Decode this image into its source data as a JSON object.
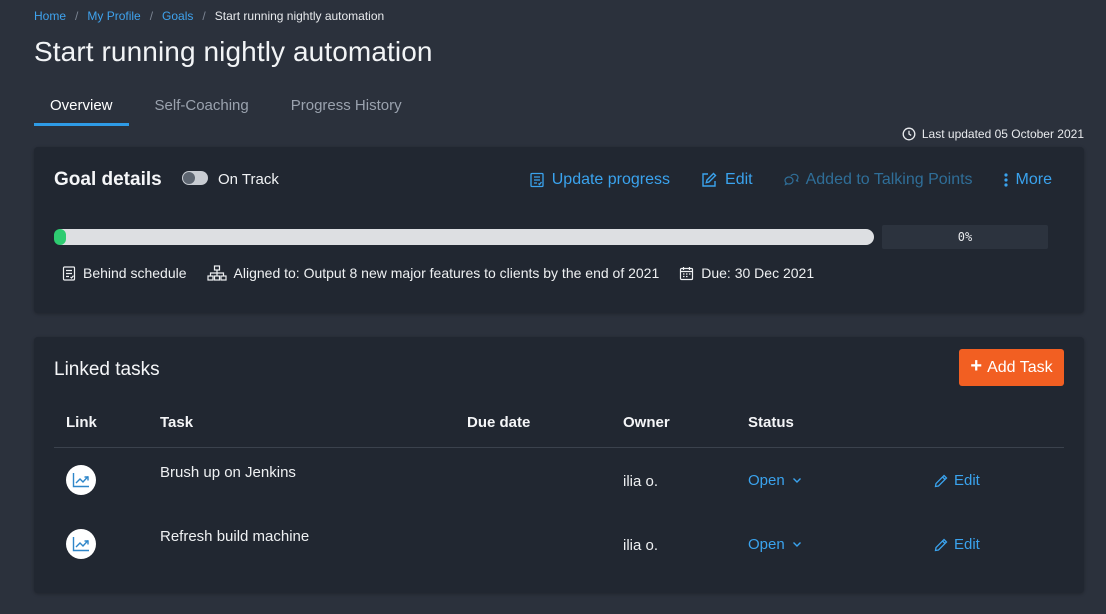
{
  "breadcrumb": {
    "items": [
      "Home",
      "My Profile",
      "Goals"
    ],
    "current": "Start running nightly automation"
  },
  "page": {
    "title": "Start running nightly automation"
  },
  "tabs": [
    {
      "label": "Overview",
      "active": true
    },
    {
      "label": "Self-Coaching",
      "active": false
    },
    {
      "label": "Progress History",
      "active": false
    }
  ],
  "last_updated": "Last updated 05 October 2021",
  "goal": {
    "heading": "Goal details",
    "status_label": "On Track",
    "status_toggle_on": false,
    "actions": {
      "update_progress": "Update progress",
      "edit": "Edit",
      "talking_points": "Added to Talking Points",
      "more": "More"
    },
    "progress_percent": 0,
    "progress_label": "0%",
    "schedule": "Behind schedule",
    "aligned": "Aligned to: Output 8 new major features to clients by the end of 2021",
    "due": "Due: 30 Dec 2021"
  },
  "tasks": {
    "heading": "Linked tasks",
    "add_button": "Add Task",
    "columns": {
      "link": "Link",
      "task": "Task",
      "due": "Due date",
      "owner": "Owner",
      "status": "Status"
    },
    "rows": [
      {
        "task": "Brush up on Jenkins",
        "due": "",
        "owner": "ilia o.",
        "status": "Open",
        "edit": "Edit"
      },
      {
        "task": "Refresh build machine",
        "due": "",
        "owner": "ilia o.",
        "status": "Open",
        "edit": "Edit"
      }
    ]
  },
  "colors": {
    "background": "#2b313c",
    "card": "#212731",
    "accent": "#3aa3ee",
    "progress": "#2ecc71",
    "add_button": "#f25f22"
  }
}
